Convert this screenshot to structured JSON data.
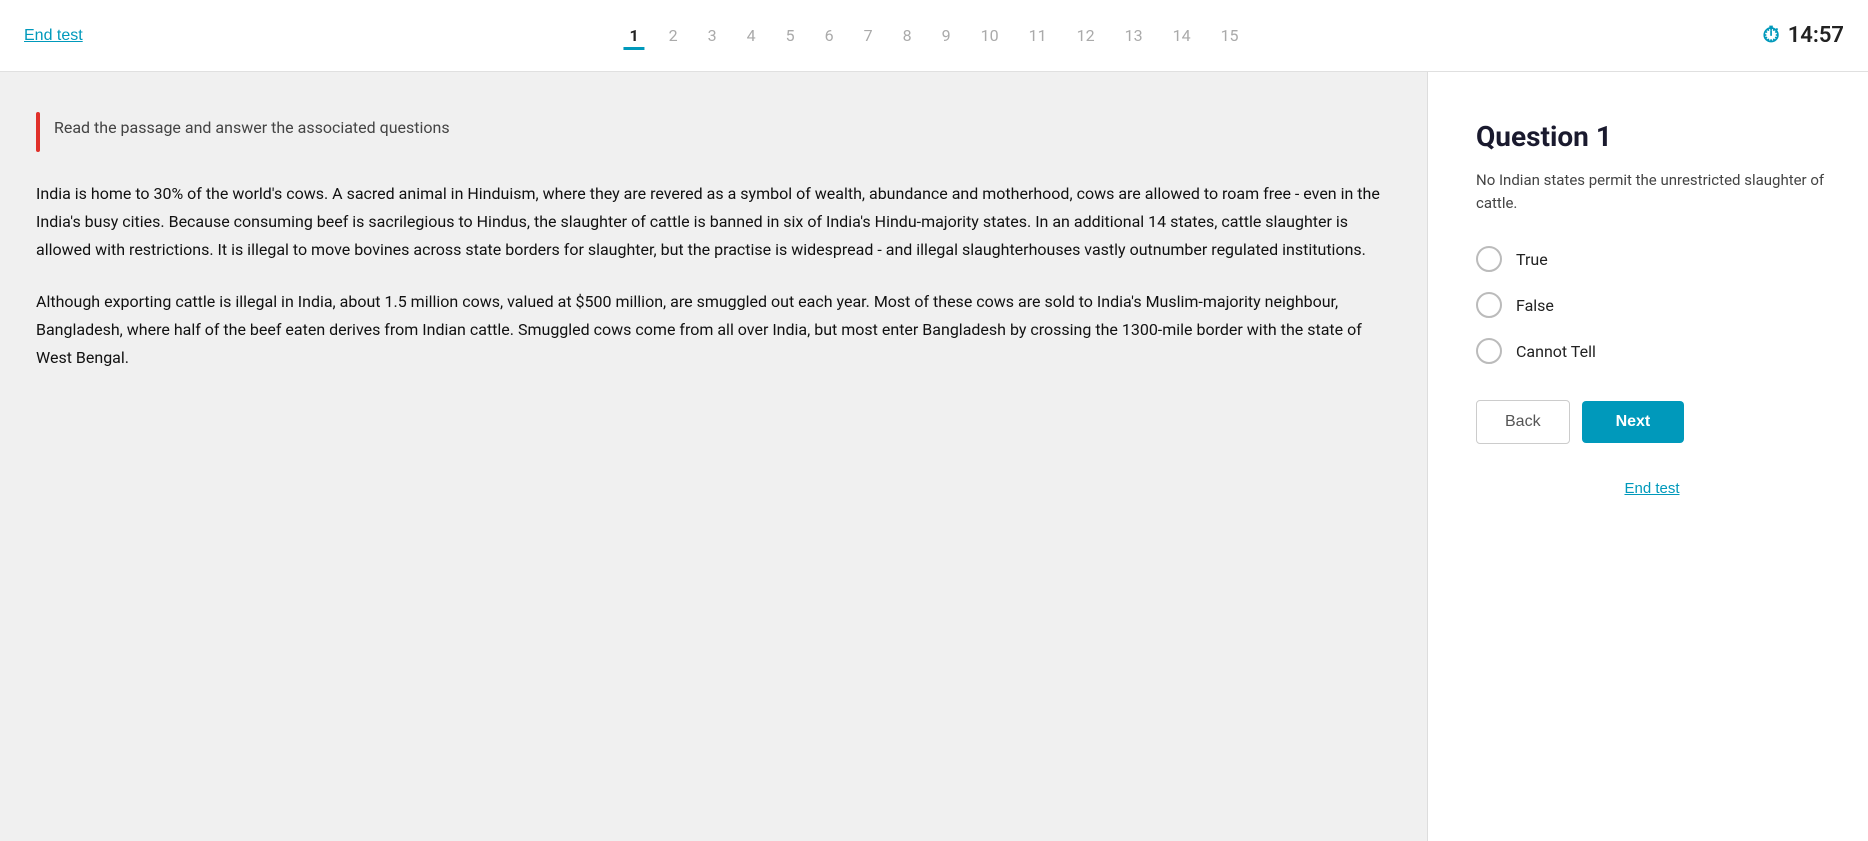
{
  "header": {
    "end_test_label": "End test",
    "nav_items": [
      {
        "label": "1",
        "active": true
      },
      {
        "label": "2",
        "active": false
      },
      {
        "label": "3",
        "active": false
      },
      {
        "label": "4",
        "active": false
      },
      {
        "label": "5",
        "active": false
      },
      {
        "label": "6",
        "active": false
      },
      {
        "label": "7",
        "active": false
      },
      {
        "label": "8",
        "active": false
      },
      {
        "label": "9",
        "active": false
      },
      {
        "label": "10",
        "active": false
      },
      {
        "label": "11",
        "active": false
      },
      {
        "label": "12",
        "active": false
      },
      {
        "label": "13",
        "active": false
      },
      {
        "label": "14",
        "active": false
      },
      {
        "label": "15",
        "active": false
      }
    ],
    "timer": "14:57"
  },
  "passage": {
    "instruction": "Read the passage and answer the associated questions",
    "paragraphs": [
      "India is home to 30% of the world's cows. A sacred animal in Hinduism, where they are revered as a symbol of wealth, abundance and motherhood, cows are allowed to roam free - even in the India's busy cities. Because consuming beef is sacrilegious to Hindus, the slaughter of cattle is banned in six of India's Hindu-majority states. In an additional 14 states, cattle slaughter is allowed with restrictions. It is illegal to move bovines across state borders for slaughter, but the practise is widespread - and illegal slaughterhouses vastly outnumber regulated institutions.",
      "Although exporting cattle is illegal in India, about 1.5 million cows, valued at $500 million, are smuggled out each year. Most of these cows are sold to India's Muslim-majority neighbour, Bangladesh, where half of the beef eaten derives from Indian cattle. Smuggled cows come from all over India, but most enter Bangladesh by crossing the 1300-mile border with the state of West Bengal."
    ]
  },
  "question": {
    "title": "Question 1",
    "text": "No Indian states permit the unrestricted slaughter of cattle.",
    "options": [
      {
        "label": "True",
        "id": "true"
      },
      {
        "label": "False",
        "id": "false"
      },
      {
        "label": "Cannot Tell",
        "id": "cannot-tell"
      }
    ],
    "back_label": "Back",
    "next_label": "Next",
    "end_test_label": "End test"
  },
  "icons": {
    "timer": "⏱"
  }
}
